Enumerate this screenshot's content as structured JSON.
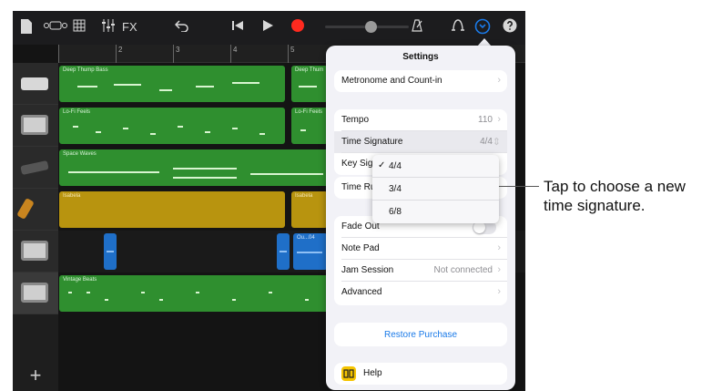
{
  "toolbar": {
    "fx_label": "FX"
  },
  "ruler": {
    "bars": [
      "2",
      "3",
      "4",
      "5"
    ]
  },
  "tracks": [
    {
      "region_name": "Deep Thump Bass",
      "region_name_2": "Deep Thum"
    },
    {
      "region_name": "Lo-Fi Feels",
      "region_name_2": "Lo-Fi Feels"
    },
    {
      "region_name": "Space Waves",
      "region_name_2": ""
    },
    {
      "region_name": "Isabela",
      "region_name_2": "Isabela"
    },
    {
      "region_name": "",
      "region_name_2": "Ou...04"
    },
    {
      "region_name": "Vintage Beats",
      "region_name_2": ""
    }
  ],
  "settings": {
    "title": "Settings",
    "metronome": "Metronome and Count-in",
    "tempo_label": "Tempo",
    "tempo_value": "110",
    "time_signature_label": "Time Signature",
    "time_signature_value": "4/4",
    "key_signature_label": "Key Sign",
    "time_ruler_label": "Time Ru",
    "fade_out_label": "Fade Out",
    "note_pad_label": "Note Pad",
    "jam_session_label": "Jam Session",
    "jam_session_value": "Not connected",
    "advanced_label": "Advanced",
    "restore_purchase": "Restore Purchase",
    "help_label": "Help"
  },
  "time_signature_menu": {
    "options": [
      "4/4",
      "3/4",
      "6/8"
    ],
    "checkmark": "✓"
  },
  "callout": {
    "line1": "Tap to choose a new",
    "line2": "time signature."
  },
  "colors": {
    "green_region": "#2f8f2f",
    "gold_region": "#b8940f",
    "blue_region": "#1f6fc8",
    "accent_blue": "#1a7ae8",
    "record_red": "#ff2a1f"
  }
}
